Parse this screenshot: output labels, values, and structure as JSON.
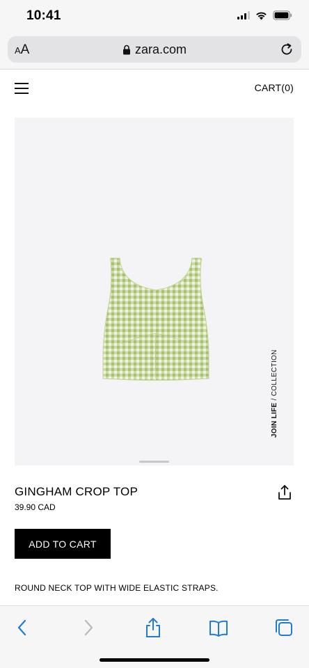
{
  "status_bar": {
    "time": "10:41"
  },
  "browser": {
    "text_size_label": "AA",
    "url": "zara.com"
  },
  "header": {
    "cart_label": "CART(0)"
  },
  "product": {
    "collection_bold": "JOIN LIFE",
    "collection_rest": " / COLLECTION",
    "title": "GINGHAM CROP TOP",
    "price": "39.90 CAD",
    "add_to_cart_label": "ADD TO CART",
    "description": "ROUND NECK TOP WITH WIDE ELASTIC STRAPS."
  },
  "icons": {
    "lock": "lock-icon",
    "reload": "reload-icon",
    "menu": "hamburger-menu-icon",
    "share": "share-icon",
    "back": "back-chevron-icon",
    "forward": "forward-chevron-icon",
    "bookmarks": "bookmarks-book-icon",
    "tabs": "tabs-icon"
  },
  "colors": {
    "accent": "#1e7bd6",
    "button_bg": "#000000",
    "image_bg": "#f4f4f6",
    "garment": "#c9d9a3"
  }
}
